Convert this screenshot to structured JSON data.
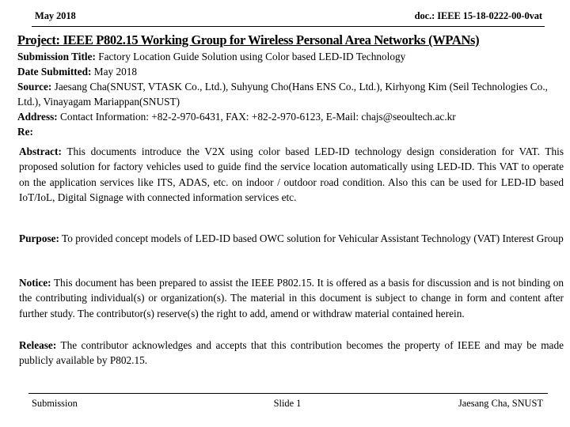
{
  "header": {
    "date": "May 2018",
    "doc_id": "doc.: IEEE 15-18-0222-00-0vat"
  },
  "project_title": "Project: IEEE P802.15 Working Group for Wireless Personal Area Networks (WPANs)",
  "meta": {
    "submission_title_label": "Submission Title:",
    "submission_title_value": " Factory Location Guide Solution using  Color based LED-ID Technology",
    "date_submitted_label": "Date Submitted:",
    "date_submitted_value": " May 2018",
    "source_label": "Source:",
    "source_value": " Jaesang Cha(SNUST, VTASK Co., Ltd.), Suhyung Cho(Hans ENS Co., Ltd.), Kirhyong Kim (Seil Technologies Co., Ltd.), Vinayagam Mariappan(SNUST)",
    "address_label": "Address:",
    "address_value": " Contact Information: +82-2-970-6431, FAX: +82-2-970-6123, E-Mail: chajs@seoultech.ac.kr",
    "re_label": "Re:",
    "re_value": ""
  },
  "sections": {
    "abstract_label": "Abstract:",
    "abstract_text": " This documents introduce the V2X using color based LED-ID technology design consideration for VAT. This proposed solution for factory vehicles used to guide find the service location automatically using LED-ID. This VAT  to operate on the application services like ITS, ADAS, etc. on indoor / outdoor road condition.  Also this can be used for LED-ID based IoT/IoL, Digital Signage with connected information services etc.",
    "purpose_label": "Purpose:",
    "purpose_text": " To provided concept models of LED-ID based OWC solution for Vehicular Assistant Technology (VAT) Interest Group",
    "notice_label": "Notice:",
    "notice_text": " This document has been prepared to assist the IEEE P802.15.  It is offered as a basis for discussion and is not binding on the contributing individual(s) or organization(s). The material in this document is subject to change in form and content after further study.  The contributor(s) reserve(s) the right to add, amend or withdraw material contained herein.",
    "release_label": "Release:",
    "release_text": " The contributor acknowledges and accepts that this contribution becomes the property of IEEE and may be made publicly available by P802.15."
  },
  "footer": {
    "left": "Submission",
    "center": "Slide 1",
    "right": "Jaesang Cha, SNUST"
  }
}
